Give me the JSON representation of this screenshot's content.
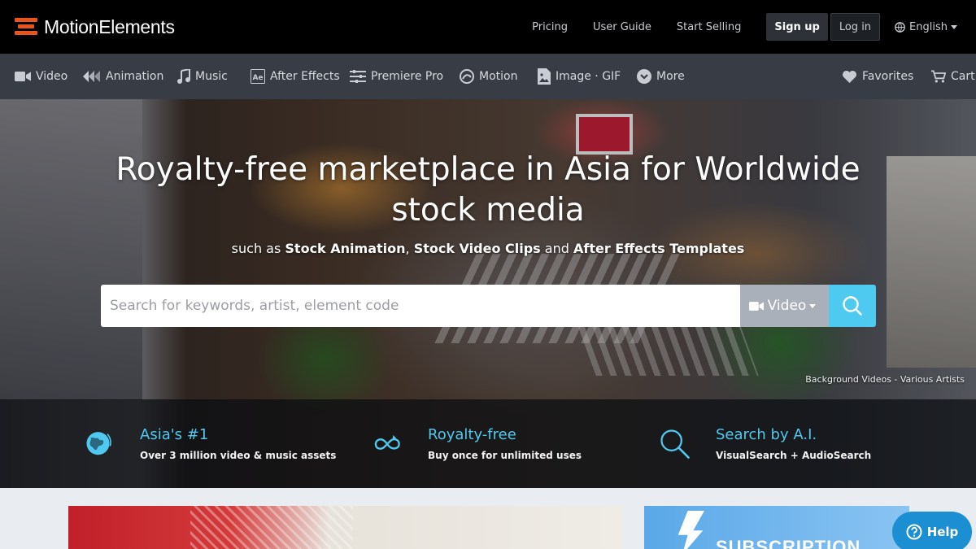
{
  "brand": {
    "name": "MotionElements",
    "accent": "#e8541e"
  },
  "topbar": {
    "links": [
      "Pricing",
      "User Guide",
      "Start Selling"
    ],
    "signup_label": "Sign up",
    "login_label": "Log in",
    "language": "English"
  },
  "nav": {
    "items": [
      {
        "label": "Video",
        "icon": "video-camera-icon"
      },
      {
        "label": "Animation",
        "icon": "animation-icon"
      },
      {
        "label": "Music",
        "icon": "music-note-icon"
      },
      {
        "label": "After Effects",
        "icon": "after-effects-icon"
      },
      {
        "label": "Premiere Pro",
        "icon": "premiere-pro-icon"
      },
      {
        "label": "Motion",
        "icon": "motion-icon"
      },
      {
        "label": "Image · GIF",
        "icon": "image-icon"
      },
      {
        "label": "More",
        "icon": "chevron-circle-icon"
      }
    ],
    "favorites_label": "Favorites",
    "cart_label": "Cart"
  },
  "hero": {
    "title_line1": "Royalty-free marketplace in Asia for Worldwide",
    "title_line2": "stock media",
    "sub_prefix": "such as ",
    "sub_b1": "Stock Animation",
    "sub_sep1": ", ",
    "sub_b2": "Stock Video Clips",
    "sub_sep2": " and ",
    "sub_b3": "After Effects Templates",
    "search_placeholder": "Search for keywords, artist, element code",
    "search_type": "Video",
    "credit": "Background Videos - Various Artists",
    "accent": "#4ec9ef"
  },
  "features": [
    {
      "title": "Asia's #1",
      "desc": "Over 3 million video & music assets",
      "icon": "globe-asia-icon"
    },
    {
      "title": "Royalty-free",
      "desc": "Buy once for unlimited uses",
      "icon": "infinity-loop-icon"
    },
    {
      "title": "Search by A.I.",
      "desc": "VisualSearch + AudioSearch",
      "icon": "magnifier-icon"
    }
  ],
  "promo": {
    "subscription_text": "SUBSCRIPTION"
  },
  "help": {
    "label": "Help"
  }
}
